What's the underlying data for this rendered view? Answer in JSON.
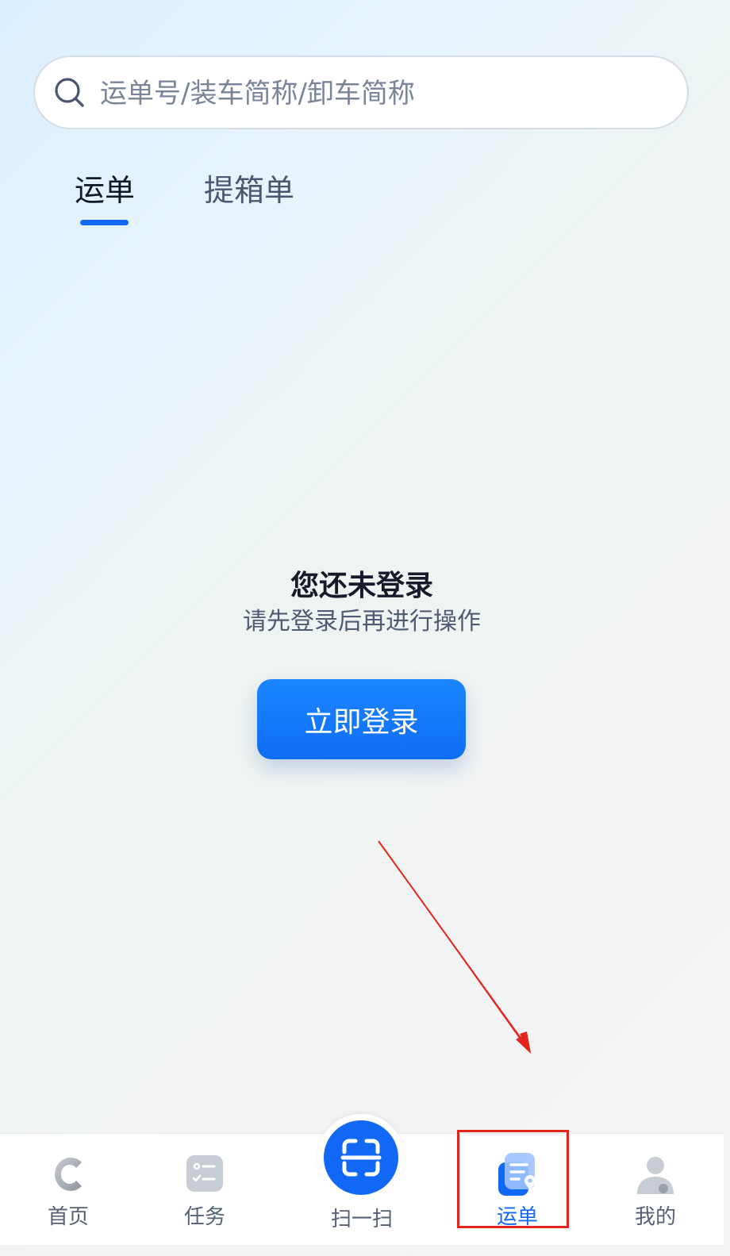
{
  "search": {
    "placeholder": "运单号/装车简称/卸车简称"
  },
  "tabs": [
    {
      "label": "运单",
      "active": true
    },
    {
      "label": "提箱单",
      "active": false
    }
  ],
  "empty_state": {
    "title": "您还未登录",
    "subtitle": "请先登录后再进行操作",
    "login_button": "立即登录"
  },
  "bottom_nav": [
    {
      "label": "首页",
      "icon": "home-c-logo-icon",
      "active": false
    },
    {
      "label": "任务",
      "icon": "task-list-icon",
      "active": false
    },
    {
      "label": "扫一扫",
      "icon": "scan-icon",
      "active": false
    },
    {
      "label": "运单",
      "icon": "waybill-icon",
      "active": true
    },
    {
      "label": "我的",
      "icon": "profile-icon",
      "active": false
    }
  ],
  "colors": {
    "accent": "#1168f5",
    "annotation": "#e3261b",
    "text_primary": "#161a2b",
    "text_secondary": "#4f5a74"
  }
}
